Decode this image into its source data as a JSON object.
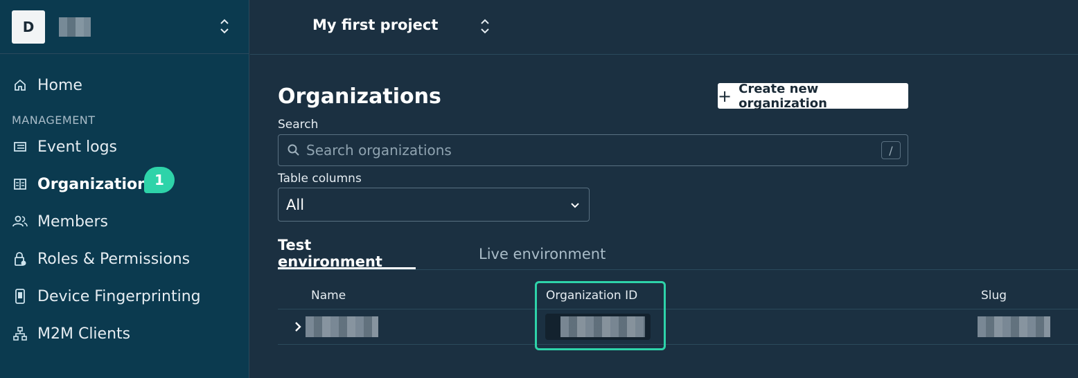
{
  "sidebar": {
    "avatar_letter": "D",
    "nav": {
      "home": "Home",
      "section_management": "MANAGEMENT",
      "event_logs": "Event logs",
      "organizations": "Organizations",
      "members": "Members",
      "roles": "Roles & Permissions",
      "device": "Device Fingerprinting",
      "m2m": "M2M Clients"
    },
    "badge_number": "1"
  },
  "header": {
    "project_name": "My first project"
  },
  "main": {
    "title": "Organizations",
    "create_button": "Create new organization",
    "search_label": "Search",
    "search_placeholder": "Search organizations",
    "search_shortcut": "/",
    "columns_label": "Table columns",
    "columns_selected": "All",
    "tabs": [
      "Test environment",
      "Live environment"
    ],
    "table_headers": [
      "Name",
      "Organization ID",
      "Slug"
    ]
  },
  "colors": {
    "accent": "#2ed3a9",
    "sidebar_bg": "#0b3a4f",
    "main_bg": "#1b3041"
  }
}
